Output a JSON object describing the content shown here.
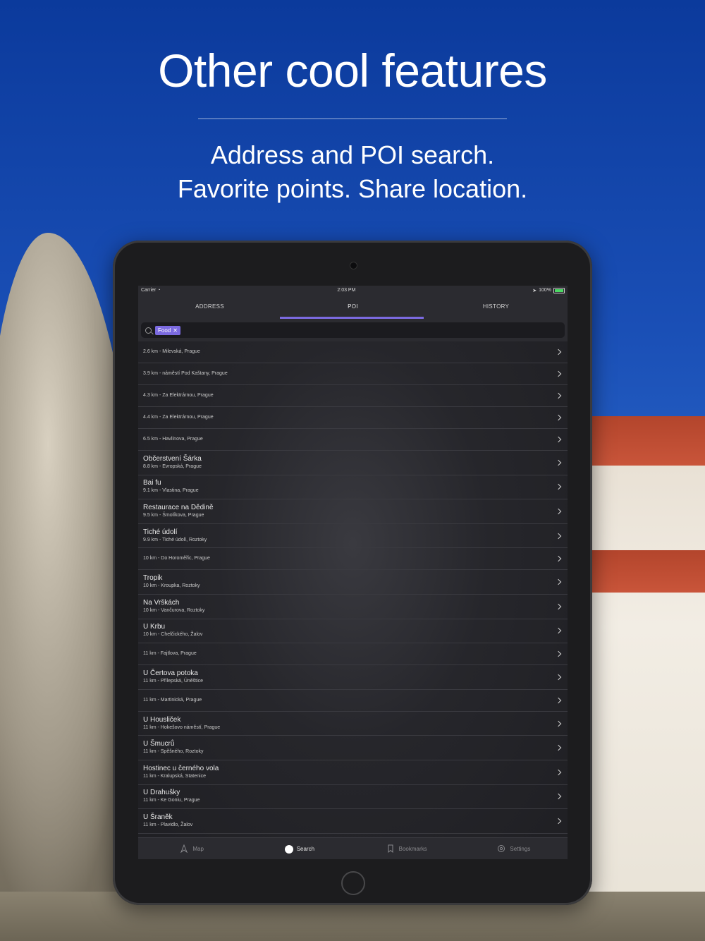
{
  "hero": {
    "title": "Other cool features",
    "subtitle_line1": "Address and POI search.",
    "subtitle_line2": "Favorite points. Share location."
  },
  "status_bar": {
    "carrier": "Carrier",
    "time": "2:03 PM",
    "battery": "100%"
  },
  "tabs": [
    {
      "label": "ADDRESS"
    },
    {
      "label": "POI"
    },
    {
      "label": "HISTORY"
    }
  ],
  "active_tab": "POI",
  "search": {
    "token": "Food"
  },
  "results": [
    {
      "name": "",
      "meta": "2.6 km - Milevská, Prague"
    },
    {
      "name": "",
      "meta": "3.9 km - náměstí Pod Kaštany, Prague"
    },
    {
      "name": "",
      "meta": "4.3 km - Za Elektrárnou, Prague"
    },
    {
      "name": "",
      "meta": "4.4 km - Za Elektrárnou, Prague"
    },
    {
      "name": "",
      "meta": "6.5 km - Havlínova, Prague"
    },
    {
      "name": "Občerstvení Šárka",
      "meta": "8.8 km - Evropská, Prague"
    },
    {
      "name": "Bai fu",
      "meta": "9.1 km - Vlastina, Prague"
    },
    {
      "name": "Restaurace na Dědině",
      "meta": "9.5 km - Šmolíkova, Prague"
    },
    {
      "name": "Tiché údolí",
      "meta": "9.9 km - Tiché údolí, Roztoky"
    },
    {
      "name": "",
      "meta": "10 km - Do Horoměřic, Prague"
    },
    {
      "name": "Tropik",
      "meta": "10 km - Kroupka, Roztoky"
    },
    {
      "name": "Na Vrškách",
      "meta": "10 km - Vančurova, Roztoky"
    },
    {
      "name": "U Krbu",
      "meta": "10 km - Chelčického, Žalov"
    },
    {
      "name": "",
      "meta": "11 km - Fajtlova, Prague"
    },
    {
      "name": "U Čertova potoka",
      "meta": "11 km - Přílepská, Úněštice"
    },
    {
      "name": "",
      "meta": "11 km - Martinická, Prague"
    },
    {
      "name": "U Housliček",
      "meta": "11 km - Hokešovo náměstí, Prague"
    },
    {
      "name": "U Šmucrů",
      "meta": "11 km - Spěšného, Roztoky"
    },
    {
      "name": "Hostinec u černého vola",
      "meta": "11 km - Kralupská, Statenice"
    },
    {
      "name": "U Drahušky",
      "meta": "11 km - Ke Goniu, Prague"
    },
    {
      "name": "U Šraněk",
      "meta": "11 km - Plavidlo, Žalov"
    }
  ],
  "tabbar": [
    {
      "label": "Map",
      "icon": "map-icon"
    },
    {
      "label": "Search",
      "icon": "search-icon"
    },
    {
      "label": "Bookmarks",
      "icon": "bookmark-icon"
    },
    {
      "label": "Settings",
      "icon": "gear-icon"
    }
  ],
  "colors": {
    "accent": "#7b6ae0",
    "sky": "#1a4fb6"
  }
}
